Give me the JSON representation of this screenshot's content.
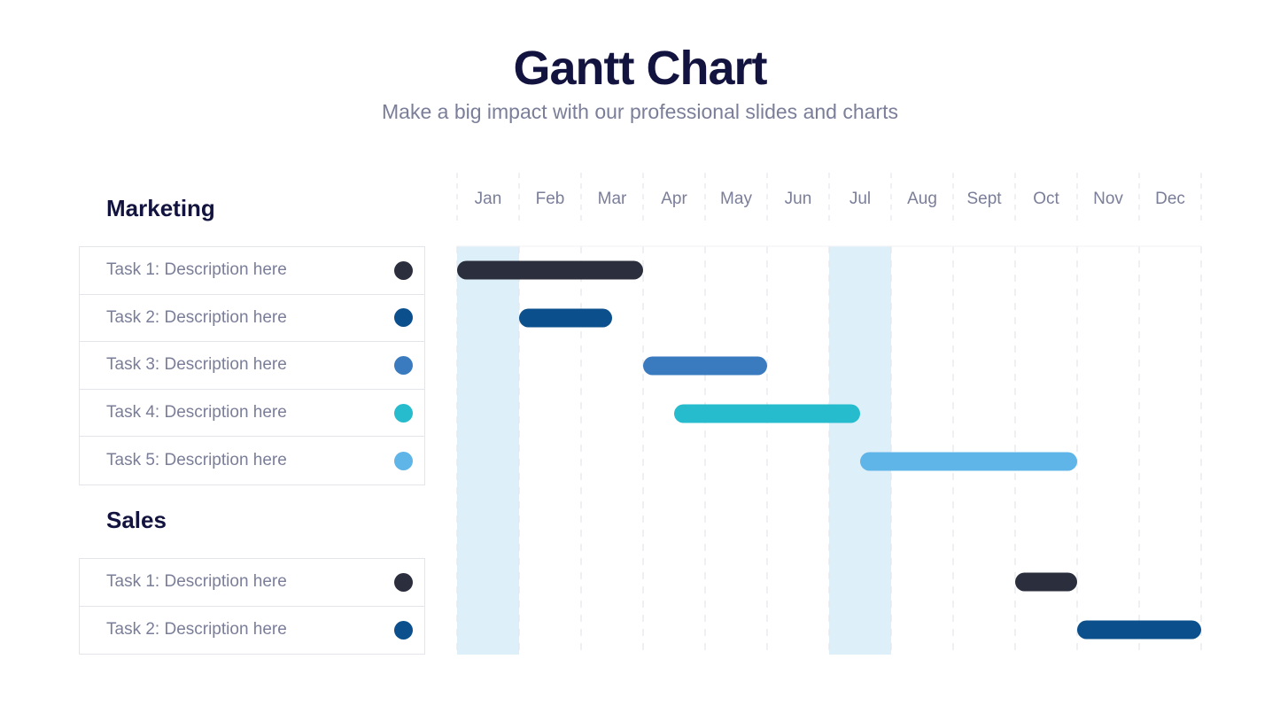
{
  "header": {
    "title": "Gantt Chart",
    "subtitle": "Make a big impact with our professional slides and charts"
  },
  "groups": [
    {
      "name": "Marketing",
      "tasks": [
        {
          "label": "Task 1: Description here",
          "color": "#2b2e3c",
          "start": 0,
          "end": 3
        },
        {
          "label": "Task 2: Description here",
          "color": "#0b4f8c",
          "start": 1,
          "end": 2.5
        },
        {
          "label": "Task 3: Description here",
          "color": "#3a7bc0",
          "start": 3,
          "end": 5
        },
        {
          "label": "Task 4: Description here",
          "color": "#26bccd",
          "start": 3.5,
          "end": 6.5
        },
        {
          "label": "Task 5: Description here",
          "color": "#5fb4e8",
          "start": 6.5,
          "end": 10
        }
      ]
    },
    {
      "name": "Sales",
      "tasks": [
        {
          "label": "Task 1: Description here",
          "color": "#2b2e3c",
          "start": 9,
          "end": 10
        },
        {
          "label": "Task 2: Description here",
          "color": "#0b4f8c",
          "start": 10,
          "end": 12
        }
      ]
    }
  ],
  "chart_data": {
    "type": "gantt",
    "title": "Gantt Chart",
    "subtitle": "Make a big impact with our professional slides and charts",
    "categories": [
      "Jan",
      "Feb",
      "Mar",
      "Apr",
      "May",
      "Jun",
      "Jul",
      "Aug",
      "Sept",
      "Oct",
      "Nov",
      "Dec"
    ],
    "highlighted_months": [
      "Jan",
      "Jul"
    ],
    "highlight_color": "#ddf0f9",
    "unit": "months from start of Jan",
    "series": [
      {
        "group": "Marketing",
        "task": "Task 1: Description here",
        "start": 0,
        "end": 3,
        "color": "#2b2e3c"
      },
      {
        "group": "Marketing",
        "task": "Task 2: Description here",
        "start": 1,
        "end": 2.5,
        "color": "#0b4f8c"
      },
      {
        "group": "Marketing",
        "task": "Task 3: Description here",
        "start": 3,
        "end": 5,
        "color": "#3a7bc0"
      },
      {
        "group": "Marketing",
        "task": "Task 4: Description here",
        "start": 3.5,
        "end": 6.5,
        "color": "#26bccd"
      },
      {
        "group": "Marketing",
        "task": "Task 5: Description here",
        "start": 6.5,
        "end": 10,
        "color": "#5fb4e8"
      },
      {
        "group": "Sales",
        "task": "Task 1: Description here",
        "start": 9,
        "end": 10,
        "color": "#2b2e3c"
      },
      {
        "group": "Sales",
        "task": "Task 2: Description here",
        "start": 10,
        "end": 12,
        "color": "#0b4f8c"
      }
    ],
    "xlim": [
      0,
      12
    ],
    "grid": true
  }
}
